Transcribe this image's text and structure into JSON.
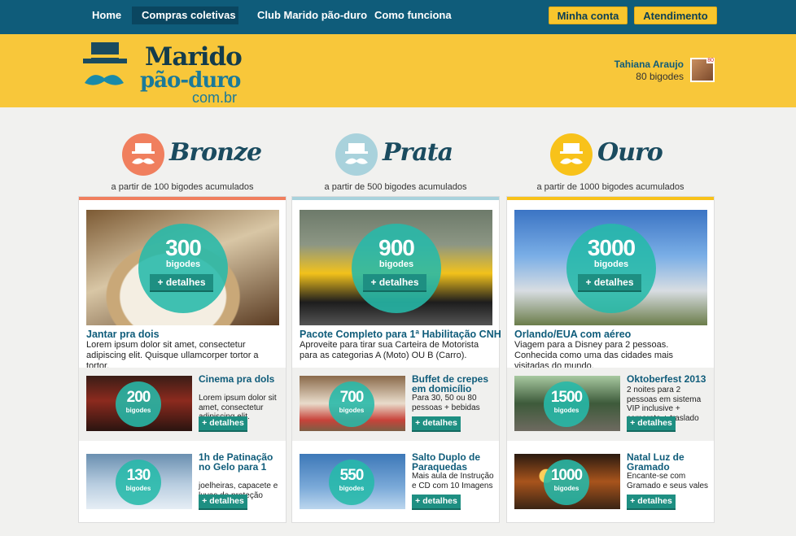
{
  "nav": {
    "items": [
      "Home",
      "Compras coletivas",
      "Club Marido pão-duro",
      "Como funciona"
    ],
    "account_label": "Minha conta",
    "support_label": "Atendimento"
  },
  "logo": {
    "line1": "Marido",
    "line2": "pão-duro",
    "domain": "com.br"
  },
  "user": {
    "name": "Tahiana Araujo",
    "points": "80 bigodes",
    "badge": "80"
  },
  "colors": {
    "nav": "#0f5c7a",
    "band": "#f8c73a",
    "teal": "#26baaa",
    "bronze": "#f07f5e",
    "prata": "#a9d2dc",
    "ouro": "#f8c21a"
  },
  "tiers": [
    {
      "title": "Bronze",
      "subtitle": "a partir de 100 bigodes acumulados",
      "featured": {
        "amount": "300",
        "unit": "bigodes",
        "button": "+ detalhes",
        "title": "Jantar pra dois",
        "desc": "Lorem ipsum dolor sit amet, consectetur adipiscing elit. Quisque ullamcorper tortor a tortor."
      },
      "items": [
        {
          "amount": "200",
          "unit": "bigodes",
          "title": "Cinema pra dols",
          "desc": "Lorem ipsum dolor sit amet, consectetur adipiscing elit.",
          "button": "+ detalhes"
        },
        {
          "amount": "130",
          "unit": "bigodes",
          "title": "1h de Patinação no Gelo para 1",
          "desc": "joelheiras, capacete e luvas de proteção",
          "button": "+ detalhes"
        }
      ]
    },
    {
      "title": "Prata",
      "subtitle": "a partir de 500 bigodes acumulados",
      "featured": {
        "amount": "900",
        "unit": "bigodes",
        "button": "+ detalhes",
        "title": "Pacote Completo para 1ª Habilitação CNH",
        "desc": "Aproveite para tirar sua Carteira de Motorista para as categorias A (Moto) OU B (Carro)."
      },
      "items": [
        {
          "amount": "700",
          "unit": "bigodes",
          "title": "Buffet de crepes em domicílio",
          "desc": "Para 30, 50 ou 80 pessoas + bebidas",
          "button": "+ detalhes"
        },
        {
          "amount": "550",
          "unit": "bigodes",
          "title": "Salto Duplo de Paraquedas",
          "desc": "Mais aula de Instrução e CD com 10 Imagens",
          "button": "+ detalhes"
        }
      ]
    },
    {
      "title": "Ouro",
      "subtitle": "a partir de 1000 bigodes acumulados",
      "featured": {
        "amount": "3000",
        "unit": "bigodes",
        "button": "+ detalhes",
        "title": "Orlando/EUA com aéreo",
        "desc": "Viagem para a Disney para 2 pessoas. Conhecida como uma das cidades mais visitadas do mundo."
      },
      "items": [
        {
          "amount": "1500",
          "unit": "bigodes",
          "title": "Oktoberfest 2013",
          "desc": "2 noites para 2 pessoas em sistema VIP inclusive + camarote + traslado",
          "button": "+ detalhes"
        },
        {
          "amount": "1000",
          "unit": "bigodes",
          "title": "Natal Luz de Gramado",
          "desc": "Encante-se com Gramado e seus vales",
          "button": "+ detalhes"
        }
      ]
    }
  ]
}
